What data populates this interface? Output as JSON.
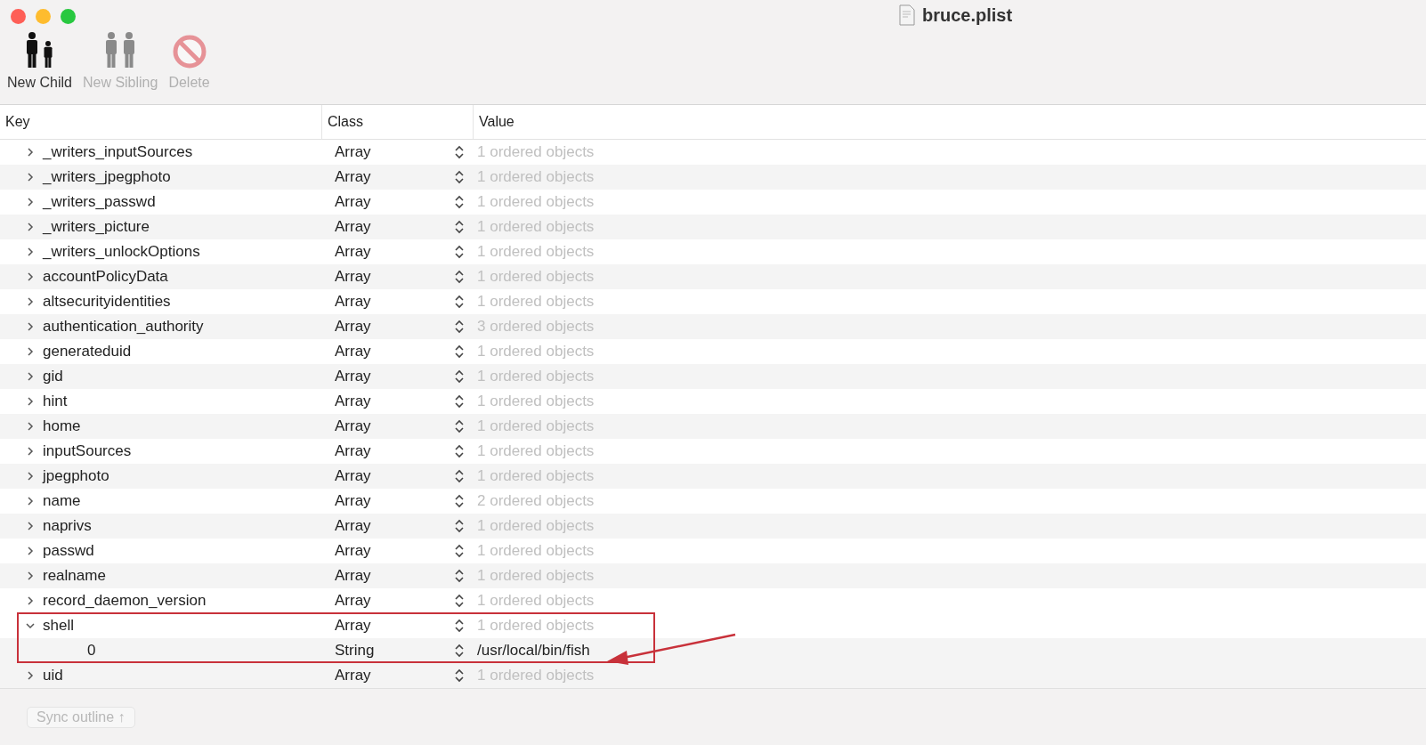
{
  "window": {
    "title": "bruce.plist"
  },
  "toolbar": [
    {
      "kind": "child",
      "label": "New Child",
      "disabled": false
    },
    {
      "kind": "sibling",
      "label": "New Sibling",
      "disabled": true
    },
    {
      "kind": "delete",
      "label": "Delete",
      "disabled": true
    }
  ],
  "table": {
    "columns": [
      "Key",
      "Class",
      "Value"
    ],
    "rows": [
      {
        "kind": "array",
        "key": "_writers_inputSources",
        "class": "Array",
        "value": "1 ordered objects",
        "expanded": false
      },
      {
        "kind": "array",
        "key": "_writers_jpegphoto",
        "class": "Array",
        "value": "1 ordered objects",
        "expanded": false
      },
      {
        "kind": "array",
        "key": "_writers_passwd",
        "class": "Array",
        "value": "1 ordered objects",
        "expanded": false
      },
      {
        "kind": "array",
        "key": "_writers_picture",
        "class": "Array",
        "value": "1 ordered objects",
        "expanded": false
      },
      {
        "kind": "array",
        "key": "_writers_unlockOptions",
        "class": "Array",
        "value": "1 ordered objects",
        "expanded": false
      },
      {
        "kind": "array",
        "key": "accountPolicyData",
        "class": "Array",
        "value": "1 ordered objects",
        "expanded": false
      },
      {
        "kind": "array",
        "key": "altsecurityidentities",
        "class": "Array",
        "value": "1 ordered objects",
        "expanded": false
      },
      {
        "kind": "array",
        "key": "authentication_authority",
        "class": "Array",
        "value": "3 ordered objects",
        "expanded": false
      },
      {
        "kind": "array",
        "key": "generateduid",
        "class": "Array",
        "value": "1 ordered objects",
        "expanded": false
      },
      {
        "kind": "array",
        "key": "gid",
        "class": "Array",
        "value": "1 ordered objects",
        "expanded": false
      },
      {
        "kind": "array",
        "key": "hint",
        "class": "Array",
        "value": "1 ordered objects",
        "expanded": false
      },
      {
        "kind": "array",
        "key": "home",
        "class": "Array",
        "value": "1 ordered objects",
        "expanded": false
      },
      {
        "kind": "array",
        "key": "inputSources",
        "class": "Array",
        "value": "1 ordered objects",
        "expanded": false
      },
      {
        "kind": "array",
        "key": "jpegphoto",
        "class": "Array",
        "value": "1 ordered objects",
        "expanded": false
      },
      {
        "kind": "array",
        "key": "name",
        "class": "Array",
        "value": "2 ordered objects",
        "expanded": false
      },
      {
        "kind": "array",
        "key": "naprivs",
        "class": "Array",
        "value": "1 ordered objects",
        "expanded": false
      },
      {
        "kind": "array",
        "key": "passwd",
        "class": "Array",
        "value": "1 ordered objects",
        "expanded": false
      },
      {
        "kind": "array",
        "key": "realname",
        "class": "Array",
        "value": "1 ordered objects",
        "expanded": false
      },
      {
        "kind": "array",
        "key": "record_daemon_version",
        "class": "Array",
        "value": "1 ordered objects",
        "expanded": false
      },
      {
        "kind": "array",
        "key": "shell",
        "class": "Array",
        "value": "1 ordered objects",
        "expanded": true,
        "highlighted": true,
        "children": [
          {
            "kind": "string",
            "key": "0",
            "class": "String",
            "value": "/usr/local/bin/fish"
          }
        ]
      },
      {
        "kind": "array",
        "key": "uid",
        "class": "Array",
        "value": "1 ordered objects",
        "expanded": false
      }
    ]
  },
  "footer": {
    "button": "Sync outline ↑"
  }
}
